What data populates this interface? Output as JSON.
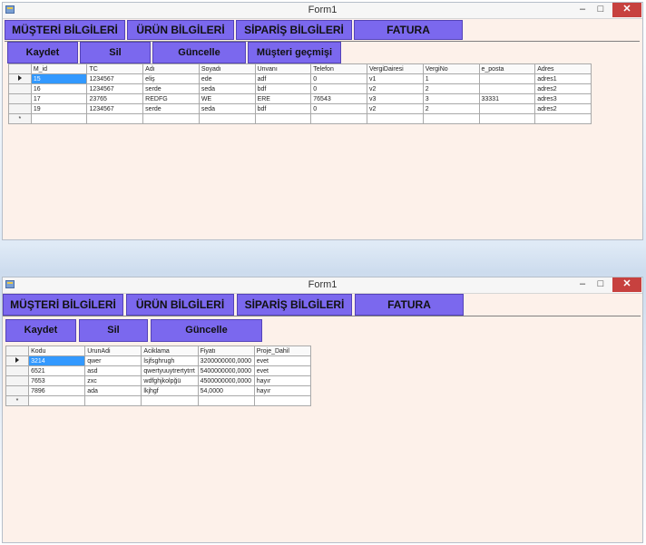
{
  "window1": {
    "title": "Form1",
    "nav": [
      "MÜŞTERİ BİLGİLERİ",
      "ÜRÜN BİLGİLERİ",
      "SİPARİŞ BİLGİLERİ",
      "FATURA"
    ],
    "actions": [
      "Kaydet",
      "Sil",
      "Güncelle",
      "Müşteri geçmişi"
    ],
    "columns": [
      "M_id",
      "TC",
      "Adı",
      "Soyadı",
      "Unvanı",
      "Telefon",
      "VergiDairesi",
      "VergiNo",
      "e_posta",
      "Adres"
    ],
    "rows": [
      [
        "15",
        "1234567",
        "eliş",
        "ede",
        "adf",
        "0",
        "v1",
        "1",
        "",
        "adres1"
      ],
      [
        "16",
        "1234567",
        "serde",
        "seda",
        "bdf",
        "0",
        "v2",
        "2",
        "",
        "adres2"
      ],
      [
        "17",
        "23765",
        "REDFG",
        "WE",
        "ERE",
        "76543",
        "v3",
        "3",
        "33331",
        "adres3"
      ],
      [
        "19",
        "1234567",
        "serde",
        "seda",
        "bdf",
        "0",
        "v2",
        "2",
        "",
        "adres2"
      ]
    ],
    "new_row_marker": "*"
  },
  "window2": {
    "title": "Form1",
    "nav": [
      "MÜŞTERİ BİLGİLERİ",
      "ÜRÜN BİLGİLERİ",
      "SİPARİŞ BİLGİLERİ",
      "FATURA"
    ],
    "actions": [
      "Kaydet",
      "Sil",
      "Güncelle"
    ],
    "columns": [
      "Kodu",
      "UrunAdi",
      "Aciklama",
      "Fiyatı",
      "Proje_Dahil"
    ],
    "rows": [
      [
        "3214",
        "qwer",
        "lsjfsghrugh",
        "3200000000,0000",
        "evet"
      ],
      [
        "6521",
        "asd",
        "qwertyuuytrertytrrt",
        "5400000000,0000",
        "evet"
      ],
      [
        "7653",
        "zxc",
        "wdfghjkolpğü",
        "4500000000,0000",
        "hayır"
      ],
      [
        "7896",
        "ada",
        "lkjhgf",
        "54,0000",
        "hayır"
      ]
    ],
    "new_row_marker": "*"
  },
  "window_controls": {
    "minimize": "–",
    "maximize": "□",
    "close": "✕"
  },
  "colors": {
    "button": "#7b68ee",
    "form_background": "#fdf1ea",
    "selected_cell": "#3399ff",
    "close_button": "#c7413f"
  }
}
